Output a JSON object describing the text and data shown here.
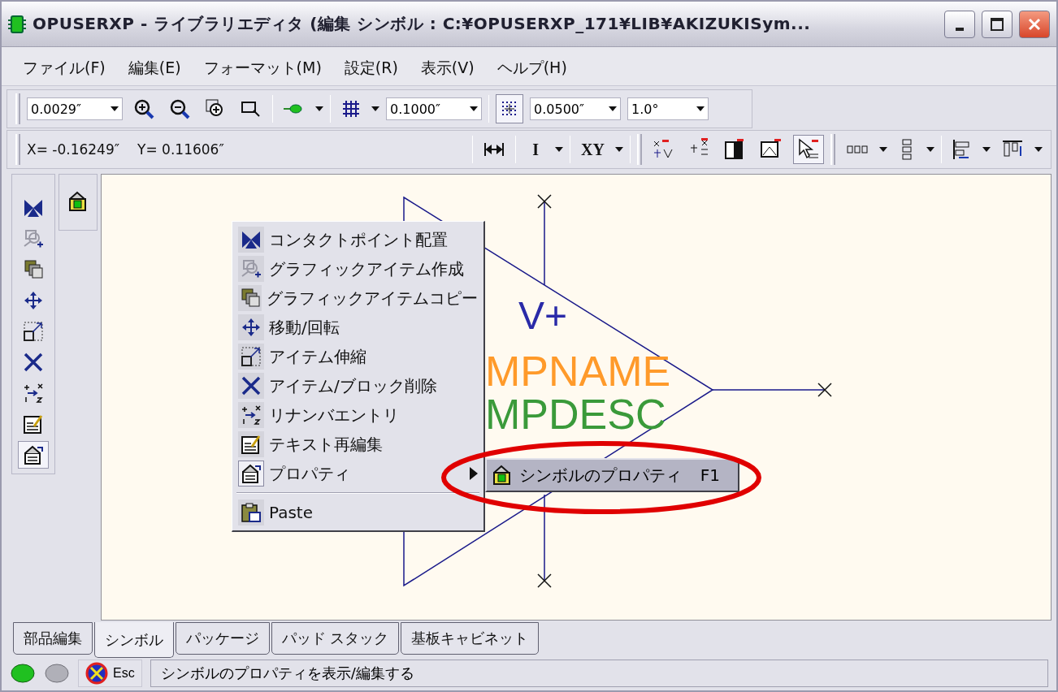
{
  "window": {
    "title": "OPUSERXP - ライブラリエディタ (編集 シンボル : C:¥OPUSERXP_171¥LIB¥AKIZUKISym..."
  },
  "menu_bar": [
    "ファイル(F)",
    "編集(E)",
    "フォーマット(M)",
    "設定(R)",
    "表示(V)",
    "ヘルプ(H)"
  ],
  "toolbar_1": {
    "zoom": "0.0029″",
    "grid": "0.1000″",
    "snap_grid_button": {
      "selected": true
    },
    "snap": "0.0500″",
    "angle": "1.0°"
  },
  "toolbar_2": {
    "x": "X= -0.16249″",
    "y": "Y= 0.11606″",
    "buttons": [
      "I",
      "XY"
    ],
    "select_button": {
      "selected": true
    }
  },
  "left_toolbar": [
    {
      "selected": false
    },
    {
      "selected": false
    },
    {
      "selected": false
    },
    {
      "selected": false
    },
    {
      "selected": false
    },
    {
      "selected": false
    },
    {
      "selected": false
    },
    {
      "selected": false
    },
    {
      "selected": true
    }
  ],
  "canvas": {
    "labels": [
      {
        "text": "V+",
        "color": "#2a2aa8"
      },
      {
        "text": "MPNAME",
        "color": "#ff9a2a"
      },
      {
        "text": "MPDESC",
        "color": "#3a9a3a"
      }
    ]
  },
  "context_menu": [
    {
      "kind": "item",
      "label": "コンタクトポイント配置",
      "selected": false,
      "submenu": false
    },
    {
      "kind": "item",
      "label": "グラフィックアイテム作成",
      "selected": false,
      "submenu": false
    },
    {
      "kind": "item",
      "label": "グラフィックアイテムコピー",
      "selected": false,
      "submenu": false
    },
    {
      "kind": "item",
      "label": "移動/回転",
      "selected": false,
      "submenu": false
    },
    {
      "kind": "item",
      "label": "アイテム伸縮",
      "selected": false,
      "submenu": false
    },
    {
      "kind": "item",
      "label": "アイテム/ブロック削除",
      "selected": false,
      "submenu": false
    },
    {
      "kind": "item",
      "label": "リナンバエントリ",
      "selected": false,
      "submenu": false
    },
    {
      "kind": "item",
      "label": "テキスト再編集",
      "selected": false,
      "submenu": false
    },
    {
      "kind": "item",
      "label": "プロパティ",
      "selected": true,
      "submenu": true
    },
    {
      "kind": "separator"
    },
    {
      "kind": "item",
      "label": "Paste",
      "selected": false,
      "submenu": false
    }
  ],
  "submenu": {
    "label": "シンボルのプロパティ",
    "shortcut": "F1",
    "selected": true
  },
  "tabs": [
    {
      "label": "部品編集",
      "selected": false
    },
    {
      "label": "シンボル",
      "selected": true
    },
    {
      "label": "パッケージ",
      "selected": false
    },
    {
      "label": "パッド スタック",
      "selected": false
    },
    {
      "label": "基板キャビネット",
      "selected": false
    }
  ],
  "status_bar": {
    "key": "Esc",
    "message": "シンボルのプロパティを表示/編集する"
  }
}
